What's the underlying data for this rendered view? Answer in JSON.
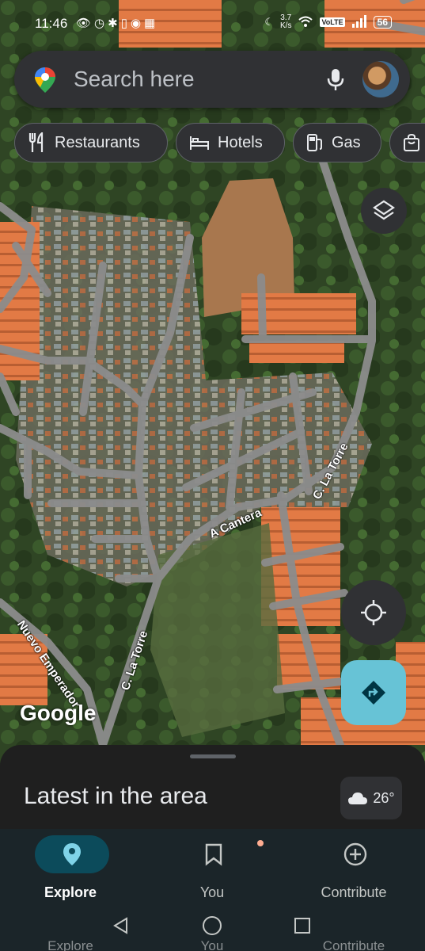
{
  "status_bar": {
    "time": "11:46",
    "net_speed_value": "3.7",
    "net_speed_unit": "K/s",
    "volte": "VoLTE",
    "battery": "56"
  },
  "search": {
    "placeholder": "Search here",
    "icons": [
      "maps-pin-icon",
      "mic-icon",
      "avatar"
    ]
  },
  "chips": [
    {
      "label": "Restaurants",
      "icon": "restaurant-icon"
    },
    {
      "label": "Hotels",
      "icon": "hotel-icon"
    },
    {
      "label": "Gas",
      "icon": "gas-icon"
    },
    {
      "label": "",
      "icon": "shopping-icon"
    }
  ],
  "map": {
    "road_labels": [
      "A Cantera",
      "C. La Torre",
      "C. La Torre",
      "Nuevo Emperador"
    ],
    "logo": "Google"
  },
  "sheet": {
    "title": "Latest in the area",
    "weather": {
      "temp": "26°",
      "icon": "cloud-icon"
    }
  },
  "bottom_nav": {
    "items": [
      {
        "label": "Explore",
        "icon": "explore-pin-icon",
        "active": true
      },
      {
        "label": "You",
        "icon": "bookmark-icon",
        "active": false
      },
      {
        "label": "Contribute",
        "icon": "add-circle-icon",
        "active": false
      }
    ]
  },
  "system_nav": {
    "ghost_labels": [
      "Explore",
      "You",
      "Contribute"
    ],
    "buttons": [
      "back-icon",
      "home-icon",
      "recents-icon"
    ]
  },
  "colors": {
    "accent": "#67c3d6",
    "surface": "#303134",
    "nav_active": "#0c4b5b"
  }
}
